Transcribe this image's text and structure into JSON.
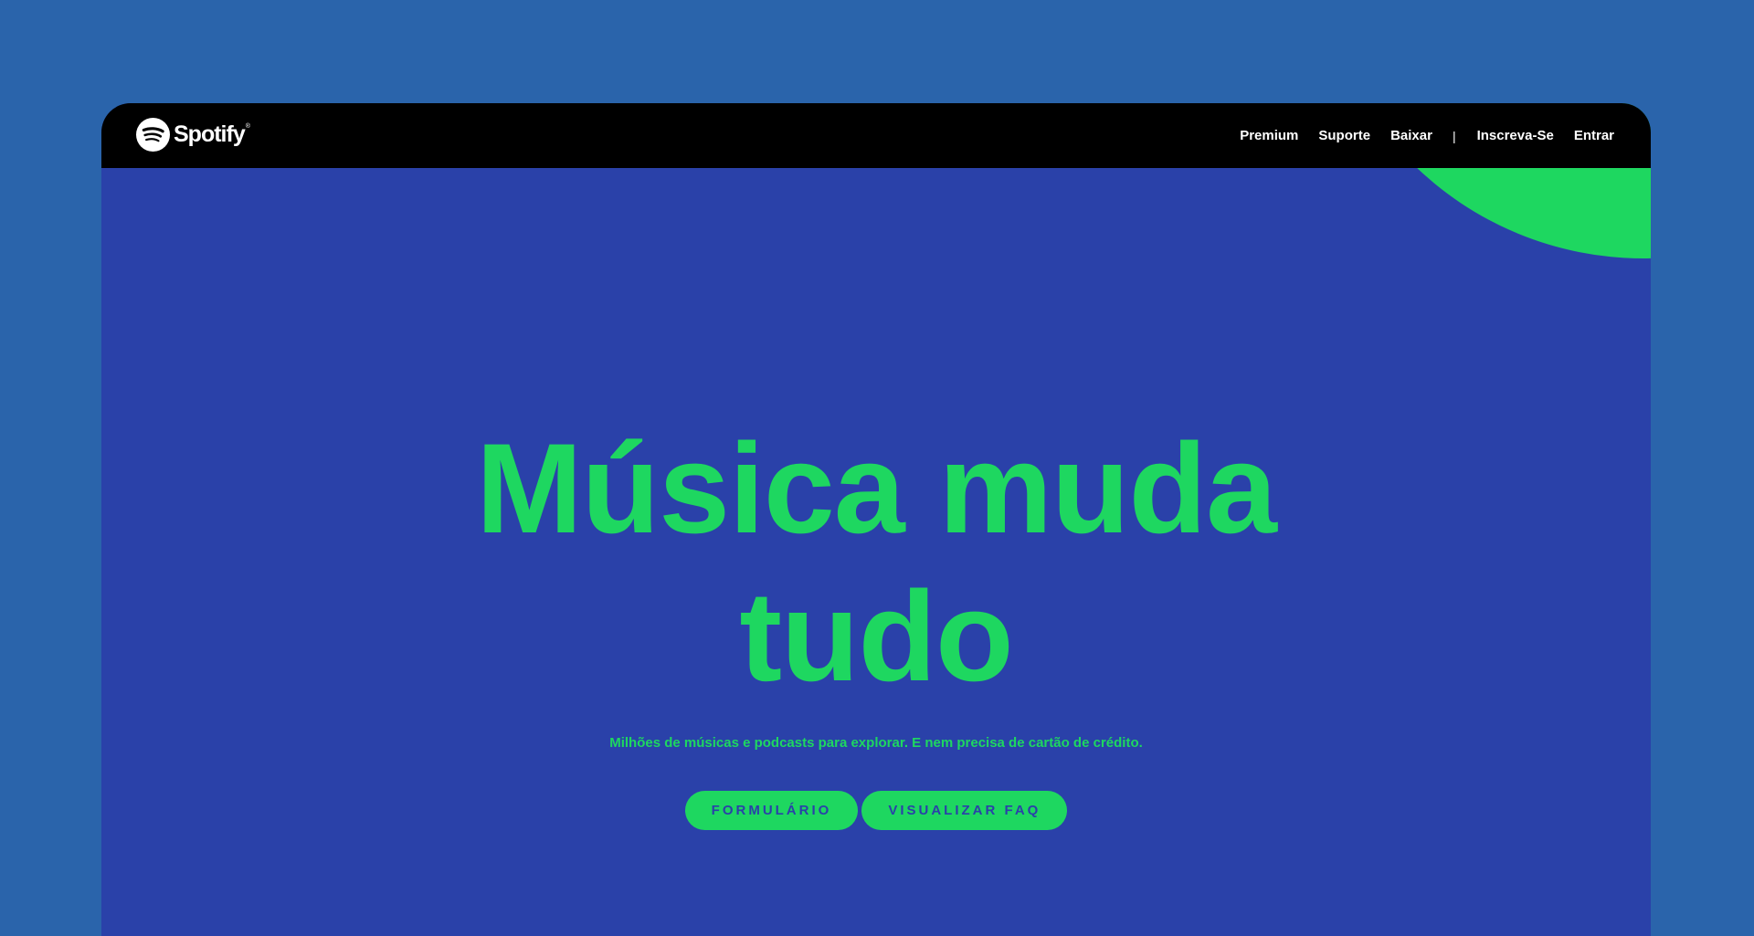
{
  "colors": {
    "page_background": "#2a64ab",
    "hero_background": "#2a41a9",
    "navbar_background": "#000000",
    "accent_green": "#1ed760",
    "nav_text": "#ffffff"
  },
  "brand": {
    "name": "Spotify",
    "trademark": "®",
    "icon": "spotify-logo-icon"
  },
  "nav": {
    "links": [
      "Premium",
      "Suporte",
      "Baixar"
    ],
    "separator": "|",
    "account_links": [
      "Inscreva-Se",
      "Entrar"
    ]
  },
  "hero": {
    "title_line1": "Música muda",
    "title_line2": "tudo",
    "subtitle": "Milhões de músicas e podcasts para explorar. E nem precisa de cartão de crédito.",
    "buttons": [
      "FORMULÁRIO",
      "VISUALIZAR FAQ"
    ]
  }
}
